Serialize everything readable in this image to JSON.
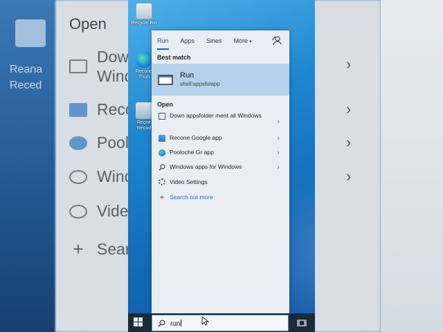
{
  "background": {
    "title": "Open",
    "rows": [
      {
        "text": "Dow",
        "text2": "Wind"
      },
      {
        "text": "Reco"
      },
      {
        "text": "Pool"
      },
      {
        "text": "Wind"
      },
      {
        "text": "Vide"
      },
      {
        "text": "Sear"
      }
    ],
    "left_labels": [
      "Reana",
      "Reced"
    ]
  },
  "desktop": {
    "icons": [
      {
        "label": "Recycle Bin",
        "name": "recycle-bin"
      },
      {
        "label": "Recone Thun",
        "name": "edge"
      },
      {
        "label": "Recne Recod",
        "name": "shortcut"
      }
    ]
  },
  "menu": {
    "tabs": [
      {
        "label": "Run",
        "active": true
      },
      {
        "label": "Apps"
      },
      {
        "label": "Sines"
      },
      {
        "label": "More",
        "caret": "▾"
      }
    ],
    "best_match_label": "Best match",
    "best_match": {
      "name": "Run",
      "subtitle": "shell:appsfolapp"
    },
    "open_label": "Open",
    "items": [
      {
        "text": "Down appsfolder ment all Windows",
        "icon": "window-icon",
        "chevron": "›"
      },
      {
        "text": "Recone Google app",
        "icon": "google-app-icon",
        "chevron": "›"
      },
      {
        "text": "Pooloche Gr app",
        "icon": "edge-icon",
        "chevron": "›"
      },
      {
        "text": "Windows apps for Windows",
        "icon": "search-icon",
        "chevron": "›"
      },
      {
        "text": "Video Settings",
        "icon": "gear-icon"
      },
      {
        "text": "Search out more",
        "icon": "plus-icon",
        "link": true
      }
    ]
  },
  "taskbar": {
    "search_value": "run"
  },
  "colors": {
    "accent": "#1a67b8",
    "highlight": "#b5d2ea",
    "menu_bg": "#e9eef2",
    "taskbar_bg": "#1b2a38"
  }
}
